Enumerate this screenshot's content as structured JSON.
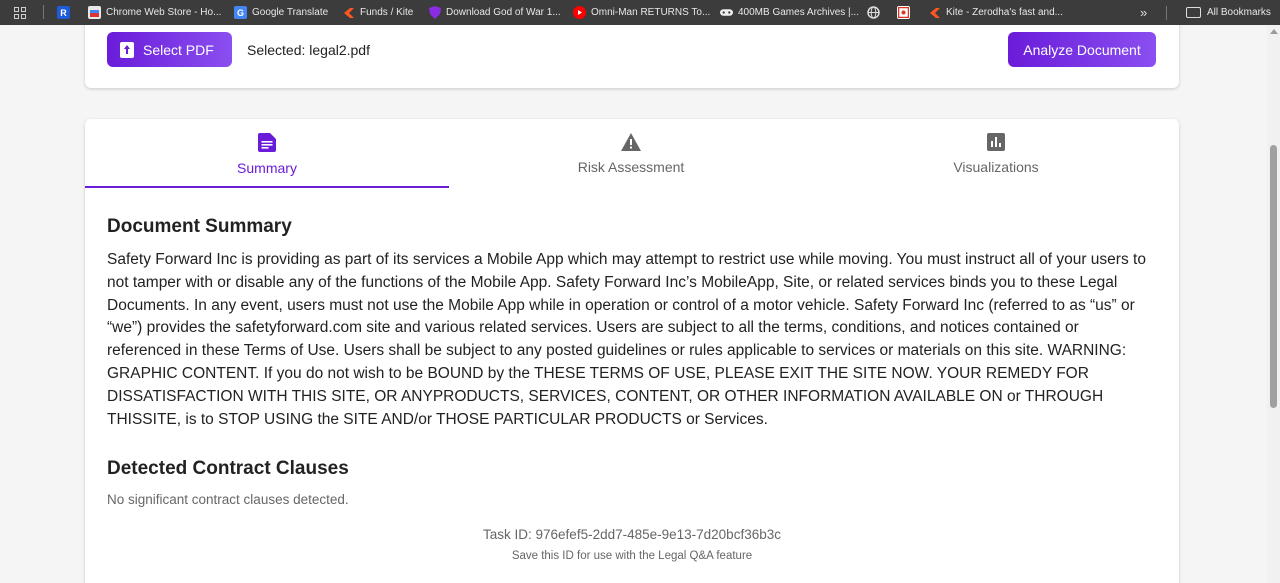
{
  "bookmarks": {
    "items": [
      {
        "label": "",
        "icon": "r-app-icon"
      },
      {
        "label": "Chrome Web Store - Ho...",
        "icon": "chrome-web-store-icon"
      },
      {
        "label": "Google Translate",
        "icon": "google-translate-icon"
      },
      {
        "label": "Funds / Kite",
        "icon": "kite-icon"
      },
      {
        "label": "Download God of War 1...",
        "icon": "purple-shield-icon"
      },
      {
        "label": "Omni-Man RETURNS To...",
        "icon": "youtube-icon"
      },
      {
        "label": "400MB Games Archives |...",
        "icon": "gamepad-icon"
      },
      {
        "label": "",
        "icon": "globe-icon"
      },
      {
        "label": "",
        "icon": "red-square-icon"
      },
      {
        "label": "Kite - Zerodha's fast and...",
        "icon": "kite-icon"
      }
    ],
    "more_glyph": "»",
    "all_bookmarks": "All Bookmarks"
  },
  "upload": {
    "select_label": "Select PDF",
    "selected_text": "Selected: legal2.pdf",
    "analyze_label": "Analyze Document"
  },
  "tabs": [
    {
      "label": "Summary",
      "active": true,
      "icon": "document-icon"
    },
    {
      "label": "Risk Assessment",
      "active": false,
      "icon": "warning-icon"
    },
    {
      "label": "Visualizations",
      "active": false,
      "icon": "bar-chart-icon"
    }
  ],
  "summary": {
    "title": "Document Summary",
    "body": "Safety Forward Inc is providing as part of its services a Mobile App which may attempt to restrict use while moving. You must instruct all of your users to not tamper with or disable any of the functions of the Mobile App. Safety Forward Inc’s MobileApp, Site, or related services binds you to these Legal Documents. In any event, users must not use the Mobile App while in operation or control of a motor vehicle. Safety Forward Inc (referred to as “us” or “we”) provides the safetyforward.com site and various related services. Users are subject to all the terms, conditions, and notices contained or referenced in these Terms of Use. Users shall be subject to any posted guidelines or rules applicable to services or materials on this site. WARNING: GRAPHIC CONTENT. If you do not wish to be BOUND by the THESE TERMS OF USE, PLEASE EXIT THE SITE NOW. YOUR REMEDY FOR DISSATISFACTION WITH THIS SITE, OR ANYPRODUCTS, SERVICES, CONTENT, OR OTHER INFORMATION AVAILABLE ON or THROUGH THISSITE, is to STOP USING the SITE AND/or THOSE PARTICULAR PRODUCTS or Services."
  },
  "clauses": {
    "title": "Detected Contract Clauses",
    "empty_text": "No significant contract clauses detected."
  },
  "task": {
    "id_text": "Task ID: 976efef5-2dd7-485e-9e13-7d20bcf36b3c",
    "note": "Save this ID for use with the Legal Q&A feature"
  },
  "colors": {
    "accent": "#6a1cd9",
    "accent_light": "#8a4ff0",
    "bookmark_bar": "#3c3c3c"
  }
}
